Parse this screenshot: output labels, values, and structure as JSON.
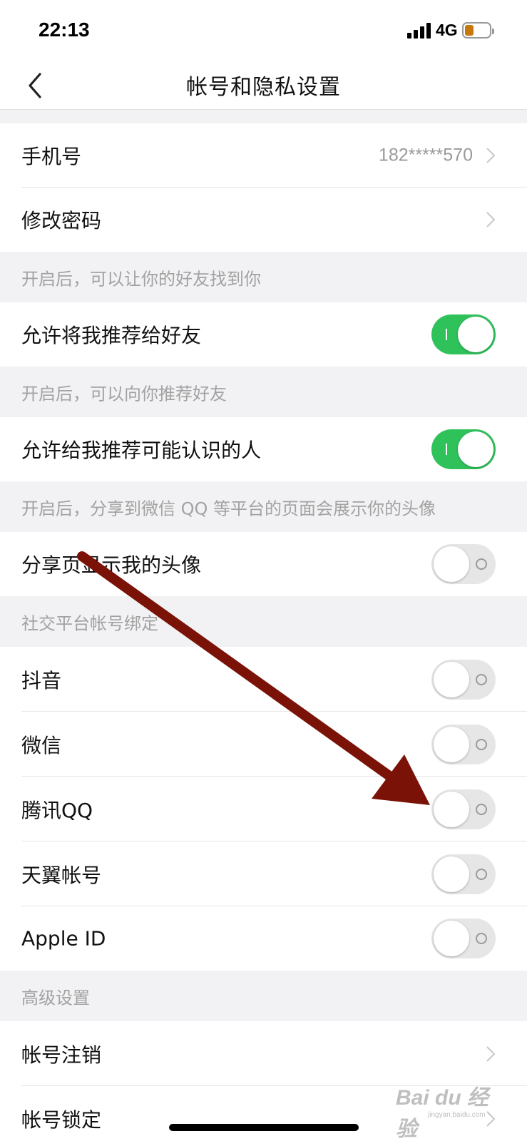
{
  "status_bar": {
    "time": "22:13",
    "network": "4G"
  },
  "nav": {
    "title": "帐号和隐私设置",
    "back_icon": "chevron-left-icon"
  },
  "rows": {
    "phone": {
      "label": "手机号",
      "value": "182*****570"
    },
    "password": {
      "label": "修改密码"
    }
  },
  "sections": {
    "find_me": {
      "caption": "开启后，可以让你的好友找到你",
      "row_label": "允许将我推荐给好友",
      "toggle_on": true
    },
    "recommend": {
      "caption": "开启后，可以向你推荐好友",
      "row_label": "允许给我推荐可能认识的人",
      "toggle_on": true
    },
    "avatar": {
      "caption": "开启后，分享到微信 QQ 等平台的页面会展示你的头像",
      "row_label": "分享页显示我的头像",
      "toggle_on": false
    },
    "social": {
      "caption": "社交平台帐号绑定",
      "items": [
        {
          "label": "抖音",
          "toggle_on": false
        },
        {
          "label": "微信",
          "toggle_on": false
        },
        {
          "label": "腾讯QQ",
          "toggle_on": false
        },
        {
          "label": "天翼帐号",
          "toggle_on": false
        },
        {
          "label": "Apple ID",
          "toggle_on": false
        }
      ]
    },
    "advanced": {
      "caption": "高级设置",
      "items": [
        {
          "label": "帐号注销"
        },
        {
          "label": "帐号锁定"
        }
      ]
    }
  },
  "overlay": {
    "arrow_color": "#7a1208"
  },
  "watermark": {
    "text": "Bai du 经验",
    "sub": "jingyan.baidu.com"
  },
  "colors": {
    "toggle_on": "#2fc25b",
    "toggle_off": "#e6e6e6",
    "caption": "#a2a2a2"
  }
}
